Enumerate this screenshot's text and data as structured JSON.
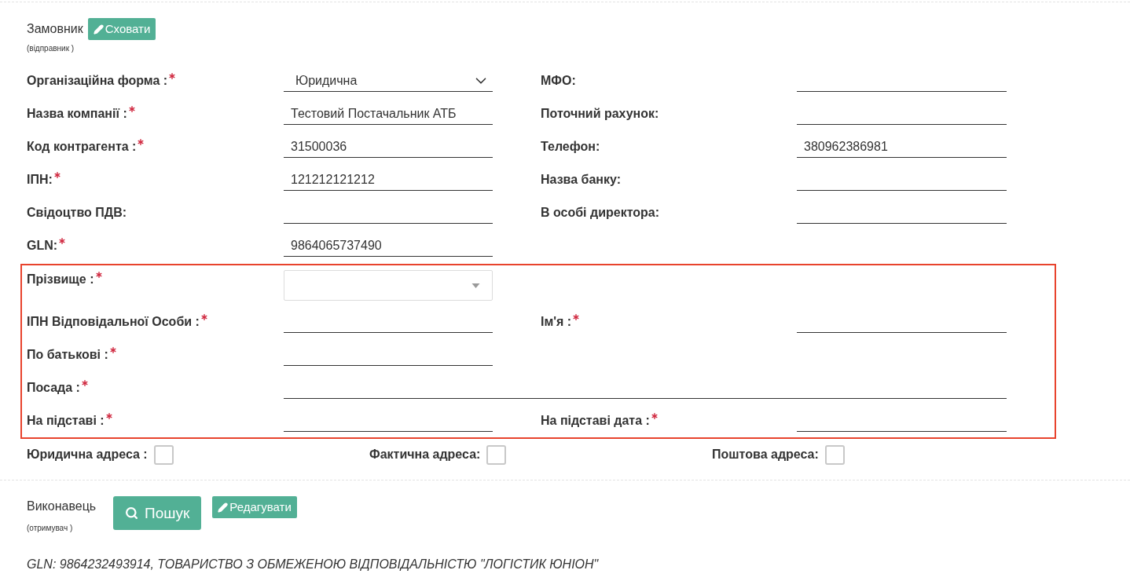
{
  "customer": {
    "title": "Замовник",
    "buttons": [
      {
        "label": "Сховати",
        "kind": "edit"
      }
    ],
    "subtitle": "(відправник )",
    "groups": [
      {
        "highlighted": false,
        "rows": [
          {
            "fields": [
              {
                "label": "Організаційна форма :",
                "required": true,
                "kind": "select",
                "value": "Юридична"
              },
              {
                "label": "МФО:",
                "required": false,
                "kind": "text"
              }
            ]
          },
          {
            "fields": [
              {
                "label": "Назва компанії :",
                "required": true,
                "kind": "text",
                "value": "Тестовий Постачальник АТБ"
              },
              {
                "label": "Поточний рахунок:",
                "required": false,
                "kind": "text"
              }
            ]
          },
          {
            "fields": [
              {
                "label": "Код контрагента :",
                "required": true,
                "kind": "text",
                "value": "31500036"
              },
              {
                "label": "Телефон:",
                "required": false,
                "kind": "text",
                "value": "380962386981"
              }
            ]
          },
          {
            "fields": [
              {
                "label": "ІПН:",
                "required": true,
                "kind": "text",
                "value": "121212121212"
              },
              {
                "label": "Назва банку:",
                "required": false,
                "kind": "text"
              }
            ]
          },
          {
            "fields": [
              {
                "label": "Свідоцтво ПДВ:",
                "required": false,
                "kind": "text"
              },
              {
                "label": "В особі директора:",
                "required": false,
                "kind": "text"
              }
            ]
          },
          {
            "fields": [
              {
                "label": "GLN:",
                "required": true,
                "kind": "text",
                "value": "9864065737490"
              }
            ]
          }
        ]
      },
      {
        "highlighted": true,
        "rows": [
          {
            "fields": [
              {
                "label": "Прізвище :",
                "required": true,
                "kind": "combo"
              }
            ]
          },
          {
            "fields": [
              {
                "label": "ІПН Відповідальної Особи :",
                "required": true,
                "kind": "text"
              },
              {
                "label": "Ім'я :",
                "required": true,
                "kind": "text"
              }
            ]
          },
          {
            "fields": [
              {
                "label": "По батькові :",
                "required": true,
                "kind": "text"
              }
            ]
          },
          {
            "fields": [
              {
                "label": "Посада :",
                "required": true,
                "kind": "wide-text"
              }
            ]
          },
          {
            "fields": [
              {
                "label": "На підставі :",
                "required": true,
                "kind": "text"
              },
              {
                "label": "На підставі дата :",
                "required": true,
                "kind": "text"
              }
            ]
          }
        ]
      }
    ],
    "address_options": [
      {
        "label": "Юридична адреса :",
        "checked": false
      },
      {
        "label": "Фактична адреса:",
        "checked": false
      },
      {
        "label": "Поштова адреса:",
        "checked": false
      }
    ]
  },
  "executor": {
    "title": "Виконавець",
    "subtitle": "(отримувач )",
    "buttons": [
      {
        "label": "Пошук",
        "kind": "search"
      },
      {
        "label": "Редагувати",
        "kind": "edit"
      }
    ],
    "summary": "GLN: 9864232493914, ТОВАРИСТВО З ОБМЕЖЕНОЮ ВІДПОВІДАЛЬНІСТЮ \"ЛОГІСТИК ЮНІОН\""
  }
}
